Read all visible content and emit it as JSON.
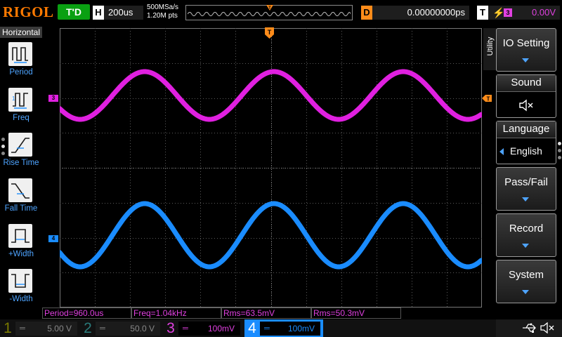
{
  "header": {
    "brand": "RIGOL",
    "run_state": "T'D",
    "horizontal_letter": "H",
    "timebase": "200us",
    "sample_rate": "500MSa/s",
    "memory_depth": "1.20M pts",
    "delay_letter": "D",
    "delay": "0.00000000ps",
    "trigger_letter": "T",
    "trigger_source": "3",
    "trigger_level": "0.00V"
  },
  "left_menu": {
    "title": "Horizontal",
    "items": [
      {
        "label": "Period",
        "icon": "period-icon"
      },
      {
        "label": "Freq",
        "icon": "frequency-icon"
      },
      {
        "label": "Rise Time",
        "icon": "rise-time-icon"
      },
      {
        "label": "Fall Time",
        "icon": "fall-time-icon"
      },
      {
        "label": "+Width",
        "icon": "positive-width-icon"
      },
      {
        "label": "-Width",
        "icon": "negative-width-icon"
      }
    ]
  },
  "right_menu": {
    "tab": "Utility",
    "io_setting": "IO Setting",
    "sound_label": "Sound",
    "language_label": "Language",
    "language_value": "English",
    "pass_fail": "Pass/Fail",
    "record": "Record",
    "system": "System"
  },
  "channels_on_screen": {
    "ch3_marker": "3",
    "ch4_marker": "4"
  },
  "measurements": [
    {
      "text": "Period=960.0us",
      "color": "#e040e0"
    },
    {
      "text": "Freq=1.04kHz",
      "color": "#e040e0"
    },
    {
      "text": "Rms=63.5mV",
      "color": "#e040e0"
    },
    {
      "text": "Rms=50.3mV",
      "color": "#e040e0"
    }
  ],
  "channel_bar": [
    {
      "num": "1",
      "scale": "5.00 V",
      "color": "#b8b800"
    },
    {
      "num": "2",
      "scale": "50.0 V",
      "color": "#00b8b8"
    },
    {
      "num": "3",
      "scale": "100mV",
      "color": "#e040e0"
    },
    {
      "num": "4",
      "scale": "100mV",
      "color": "#1e90ff"
    }
  ],
  "colors": {
    "ch3": "#e020e0",
    "ch4": "#1a8cff",
    "trigger": "#ff8c1a",
    "grid": "#5a5a5a"
  }
}
